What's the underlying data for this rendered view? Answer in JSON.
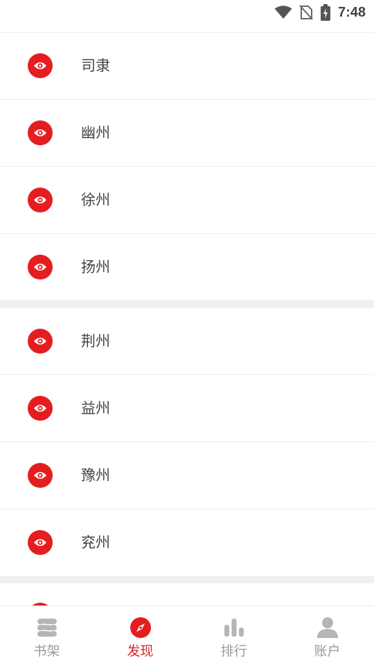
{
  "status_bar": {
    "time": "7:48",
    "icons": [
      "wifi-icon",
      "no-sim-icon",
      "battery-charging-icon"
    ]
  },
  "list": {
    "group1": [
      {
        "label": "司隶",
        "icon": "eye-icon"
      },
      {
        "label": "幽州",
        "icon": "eye-icon"
      },
      {
        "label": "徐州",
        "icon": "eye-icon"
      },
      {
        "label": "扬州",
        "icon": "eye-icon"
      }
    ],
    "group2": [
      {
        "label": "荆州",
        "icon": "eye-icon"
      },
      {
        "label": "益州",
        "icon": "eye-icon"
      },
      {
        "label": "豫州",
        "icon": "eye-icon"
      },
      {
        "label": "兖州",
        "icon": "eye-icon"
      }
    ]
  },
  "bottom_nav": {
    "items": [
      {
        "label": "书架",
        "icon": "bookshelf-icon",
        "active": false
      },
      {
        "label": "发现",
        "icon": "compass-icon",
        "active": true
      },
      {
        "label": "排行",
        "icon": "bar-chart-icon",
        "active": false
      },
      {
        "label": "账户",
        "icon": "user-icon",
        "active": false
      }
    ]
  },
  "colors": {
    "accent": "#e41e20",
    "inactive": "#9a9a9a",
    "divider": "#ececec",
    "group_gap": "#f0f0f0"
  }
}
